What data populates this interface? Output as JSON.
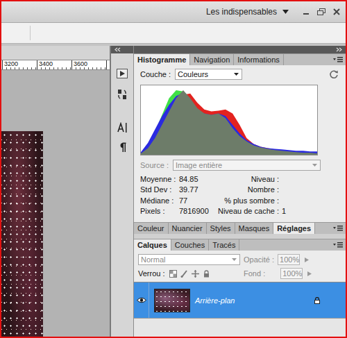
{
  "workspace": {
    "label": "Les indispensables"
  },
  "ruler": {
    "ticks": [
      "3200",
      "3400",
      "3600"
    ]
  },
  "histogram_panel": {
    "tabs": [
      {
        "label": "Histogramme",
        "selected": true
      },
      {
        "label": "Navigation",
        "selected": false
      },
      {
        "label": "Informations",
        "selected": false
      }
    ],
    "channel": {
      "label": "Couche :",
      "value": "Couleurs"
    },
    "chart": {
      "series": [
        {
          "color": "#e3231f",
          "values": [
            1,
            4,
            12,
            28,
            48,
            70,
            90,
            92,
            78,
            68,
            65,
            66,
            68,
            62,
            45,
            25,
            16,
            12,
            10,
            8,
            7,
            6,
            5,
            4,
            3,
            2
          ]
        },
        {
          "color": "#3fe046",
          "values": [
            3,
            15,
            35,
            60,
            85,
            97,
            95,
            80,
            65,
            58,
            55,
            50,
            40,
            28,
            18,
            13,
            10,
            8,
            7,
            6,
            5,
            4,
            3,
            3,
            2,
            2
          ]
        },
        {
          "color": "#2a2ae0",
          "values": [
            4,
            18,
            38,
            58,
            75,
            88,
            93,
            82,
            68,
            62,
            60,
            62,
            58,
            45,
            32,
            22,
            16,
            12,
            10,
            9,
            8,
            7,
            6,
            6,
            5,
            5
          ]
        },
        {
          "color": "#6d7c69",
          "values": [
            2,
            10,
            25,
            45,
            65,
            85,
            97,
            85,
            70,
            62,
            60,
            62,
            55,
            40,
            28,
            20,
            14,
            11,
            9,
            7,
            6,
            5,
            4,
            3,
            3,
            2
          ]
        }
      ]
    },
    "source": {
      "label": "Source :",
      "value": "Image entière",
      "disabled": true
    },
    "stats_left": [
      {
        "label": "Moyenne :",
        "value": "84.85"
      },
      {
        "label": "Std Dev :",
        "value": "39.77"
      },
      {
        "label": "Médiane :",
        "value": "77"
      },
      {
        "label": "Pixels :",
        "value": "7816900"
      }
    ],
    "stats_right": [
      {
        "label": "Niveau :"
      },
      {
        "label": "Nombre :"
      },
      {
        "label": "% plus sombre :"
      },
      {
        "label": "Niveau de cache :",
        "value": "1"
      }
    ]
  },
  "adjustments_panel": {
    "tabs": [
      {
        "label": "Couleur",
        "selected": false
      },
      {
        "label": "Nuancier",
        "selected": false
      },
      {
        "label": "Styles",
        "selected": false
      },
      {
        "label": "Masques",
        "selected": false
      },
      {
        "label": "Réglages",
        "selected": true
      }
    ]
  },
  "layers_panel": {
    "tabs": [
      {
        "label": "Calques",
        "selected": true
      },
      {
        "label": "Couches",
        "selected": false
      },
      {
        "label": "Tracés",
        "selected": false
      }
    ],
    "blend_mode": {
      "value": "Normal",
      "disabled": true
    },
    "opacity": {
      "label": "Opacité :",
      "value": "100%",
      "disabled": true
    },
    "lock": {
      "label": "Verrou :"
    },
    "fill": {
      "label": "Fond :",
      "value": "100%",
      "disabled": true
    },
    "layers": [
      {
        "name": "Arrière-plan",
        "visible": true,
        "selected": true,
        "locked": true
      }
    ]
  }
}
